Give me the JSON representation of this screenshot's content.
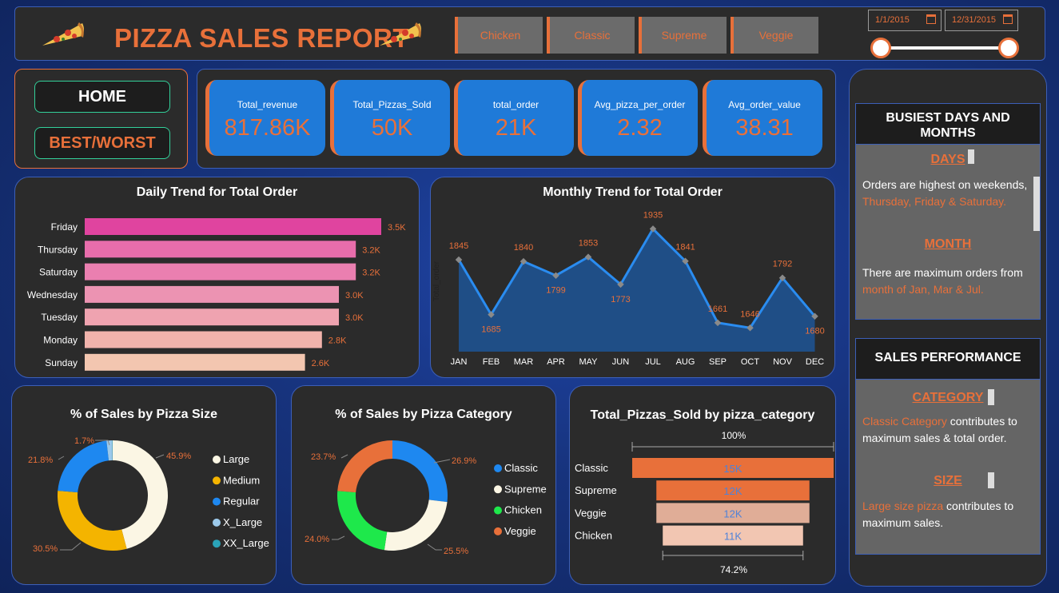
{
  "header": {
    "title": "PIZZA SALES REPORT",
    "slicers": [
      "Chicken",
      "Classic",
      "Supreme",
      "Veggie"
    ],
    "date_start": "1/1/2015",
    "date_end": "12/31/2015"
  },
  "nav": {
    "home": "HOME",
    "best_worst": "BEST/WORST"
  },
  "kpis": [
    {
      "label": "Total_revenue",
      "value": "817.86K"
    },
    {
      "label": "Total_Pizzas_Sold",
      "value": "50K"
    },
    {
      "label": "total_order",
      "value": "21K"
    },
    {
      "label": "Avg_pizza_per_order",
      "value": "2.32"
    },
    {
      "label": "Avg_order_value",
      "value": "38.31"
    }
  ],
  "colors": {
    "accent": "#e8703a",
    "kpi_blue": "#1f7ad8",
    "panel": "#2b2b2b",
    "line_blue": "#2a8cf0"
  },
  "sidebar": {
    "busiest_title": "BUSIEST DAYS AND MONTHS",
    "days_label": "DAYS",
    "days_text": {
      "p1": "Orders are ",
      "p2": "highest",
      "p3": " on weekends, ",
      "p4": "Thursday, Friday & Saturday."
    },
    "month_label": "MONTH",
    "month_text": {
      "p1": "There are ",
      "p2": "maximum",
      "p3": " orders from ",
      "p4": "month of Jan, Mar & Jul."
    },
    "perf_title": "SALES PERFORMANCE",
    "category_label": "CATEGORY",
    "category_text": {
      "p1": "Classic Category",
      "p2": " contributes to maximum sales & total order."
    },
    "size_label": "SIZE",
    "size_text": {
      "p1": "Large size pizza",
      "p2": " contributes to maximum sales."
    }
  },
  "chart_data": [
    {
      "type": "bar",
      "title": "Daily Trend for Total Order",
      "orientation": "horizontal",
      "categories": [
        "Friday",
        "Thursday",
        "Saturday",
        "Wednesday",
        "Tuesday",
        "Monday",
        "Sunday"
      ],
      "values": [
        3.5,
        3.2,
        3.2,
        3.0,
        3.0,
        2.8,
        2.6
      ],
      "value_labels": [
        "3.5K",
        "3.2K",
        "3.2K",
        "3.0K",
        "3.0K",
        "2.8K",
        "2.6K"
      ],
      "colors": [
        "#e0449f",
        "#e86dab",
        "#ea7fb0",
        "#ec93b2",
        "#efa3b0",
        "#f1b3ac",
        "#f3c6b0"
      ],
      "xlim": [
        0,
        3.5
      ]
    },
    {
      "type": "area",
      "title": "Monthly Trend for Total Order",
      "ylabel": "Total_order",
      "categories": [
        "JAN",
        "FEB",
        "MAR",
        "APR",
        "MAY",
        "JUN",
        "JUL",
        "AUG",
        "SEP",
        "OCT",
        "NOV",
        "DEC"
      ],
      "values": [
        1845,
        1685,
        1840,
        1799,
        1853,
        1773,
        1935,
        1841,
        1661,
        1646,
        1792,
        1680
      ],
      "ylim": [
        1600,
        1950
      ]
    },
    {
      "type": "pie",
      "title": "% of Sales by Pizza Size",
      "labels": [
        "Large",
        "Medium",
        "Regular",
        "X_Large",
        "XX_Large"
      ],
      "values": [
        45.9,
        30.5,
        21.8,
        1.7,
        0.1
      ],
      "display_labels": [
        "45.9%",
        "30.5%",
        "21.8%",
        "1.7%",
        ""
      ],
      "colors": [
        "#fbf6e4",
        "#f4b400",
        "#1e88f0",
        "#9cc9ea",
        "#2aa3b8"
      ],
      "legend": "right"
    },
    {
      "type": "pie",
      "title": "% of Sales by Pizza Category",
      "labels": [
        "Classic",
        "Supreme",
        "Chicken",
        "Veggie"
      ],
      "values": [
        26.9,
        25.5,
        24.0,
        23.7
      ],
      "display_labels": [
        "26.9%",
        "25.5%",
        "24.0%",
        "23.7%"
      ],
      "colors": [
        "#1e88f0",
        "#fbf6e4",
        "#1ee84b",
        "#e8703a"
      ],
      "legend": "right"
    },
    {
      "type": "bar",
      "title": "Total_Pizzas_Sold by pizza_category",
      "orientation": "funnel",
      "categories": [
        "Classic",
        "Supreme",
        "Veggie",
        "Chicken"
      ],
      "values": [
        15,
        12,
        12,
        11
      ],
      "value_labels": [
        "15K",
        "12K",
        "12K",
        "11K"
      ],
      "colors": [
        "#e8703a",
        "#e8703a",
        "#e0ad97",
        "#f2c6b2"
      ],
      "top_pct": "100%",
      "bottom_pct": "74.2%"
    }
  ]
}
